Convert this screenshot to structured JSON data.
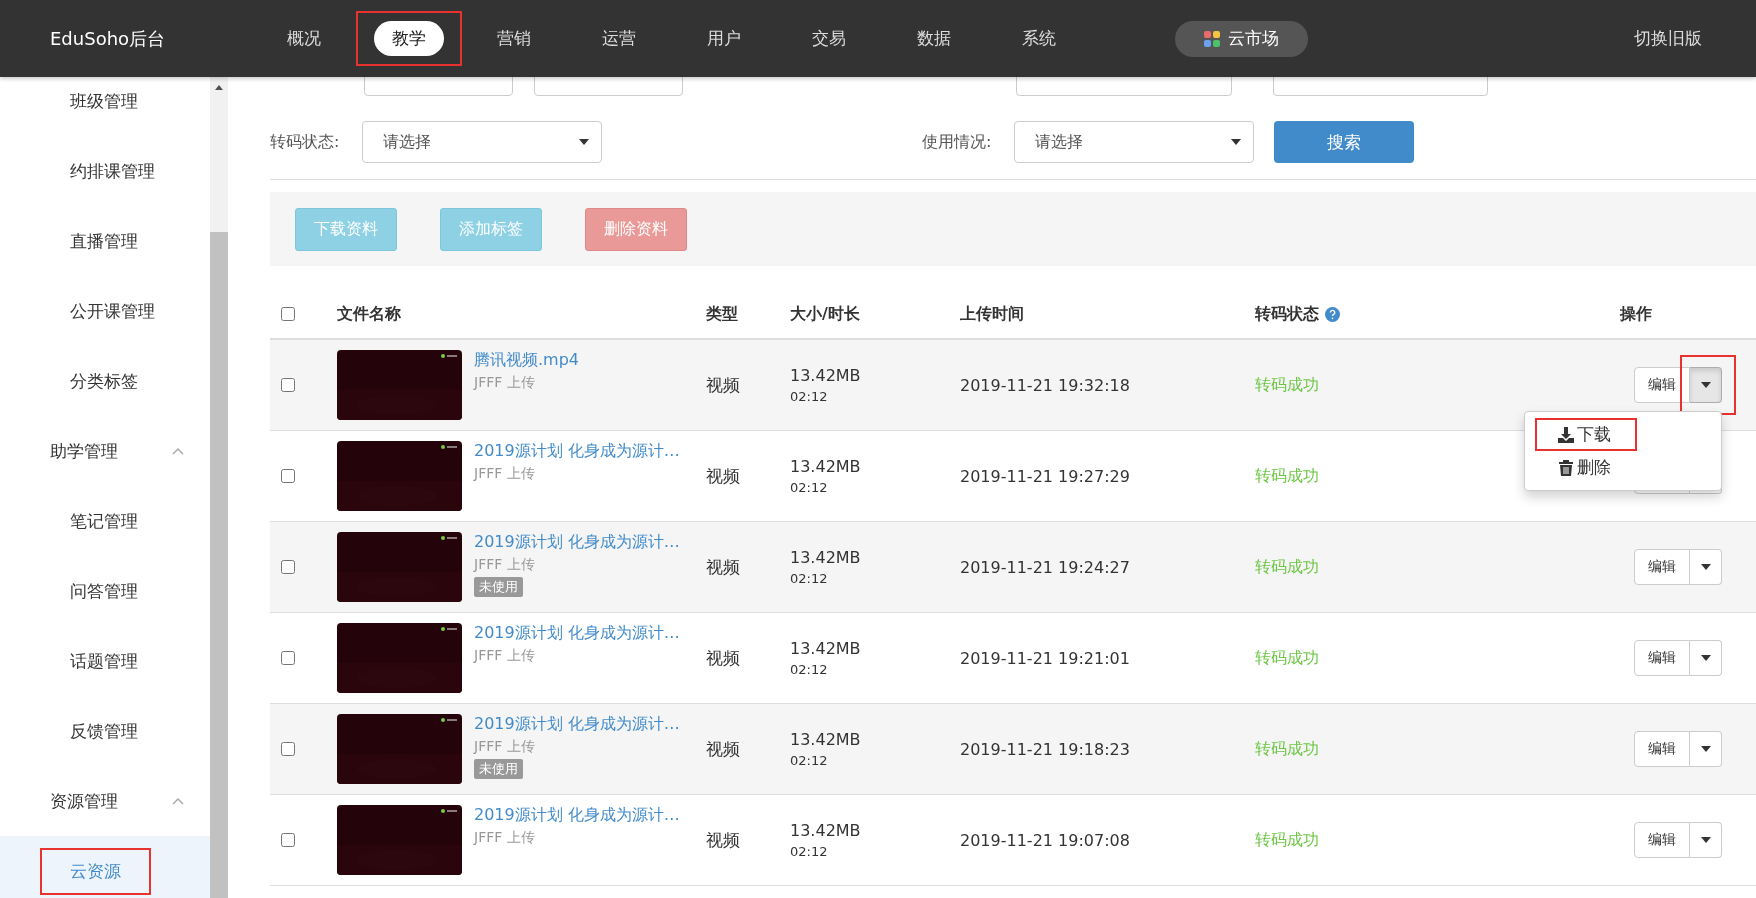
{
  "header": {
    "logo": "EduSoho后台",
    "nav": [
      {
        "label": "概况",
        "selected": false,
        "highlighted": false
      },
      {
        "label": "教学",
        "selected": true,
        "highlighted": true
      },
      {
        "label": "营销",
        "selected": false,
        "highlighted": false
      },
      {
        "label": "运营",
        "selected": false,
        "highlighted": false
      },
      {
        "label": "用户",
        "selected": false,
        "highlighted": false
      },
      {
        "label": "交易",
        "selected": false,
        "highlighted": false
      },
      {
        "label": "数据",
        "selected": false,
        "highlighted": false
      },
      {
        "label": "系统",
        "selected": false,
        "highlighted": false
      }
    ],
    "market": "云市场",
    "switch_link": "切换旧版"
  },
  "sidebar": {
    "items": [
      {
        "label": "班级管理",
        "selected": false,
        "highlighted": false
      },
      {
        "label": "约排课管理",
        "selected": false,
        "highlighted": false
      },
      {
        "label": "直播管理",
        "selected": false,
        "highlighted": false
      },
      {
        "label": "公开课管理",
        "selected": false,
        "highlighted": false
      },
      {
        "label": "分类标签",
        "selected": false,
        "highlighted": false
      },
      {
        "label": "助学管理",
        "selected": false,
        "highlighted": false,
        "expanded": true,
        "children": [
          {
            "label": "笔记管理",
            "selected": false,
            "highlighted": false
          },
          {
            "label": "问答管理",
            "selected": false,
            "highlighted": false
          },
          {
            "label": "话题管理",
            "selected": false,
            "highlighted": false
          },
          {
            "label": "反馈管理",
            "selected": false,
            "highlighted": false
          }
        ]
      },
      {
        "label": "资源管理",
        "selected": false,
        "highlighted": false,
        "expanded": true,
        "children": [
          {
            "label": "云资源",
            "selected": true,
            "highlighted": true
          }
        ]
      }
    ]
  },
  "filters": {
    "transcode": {
      "label": "转码状态:",
      "value": "请选择"
    },
    "usage": {
      "label": "使用情况:",
      "value": "请选择"
    },
    "search_button": "搜索"
  },
  "toolbar": {
    "buttons": [
      {
        "label": "下载资料",
        "kind": "info"
      },
      {
        "label": "添加标签",
        "kind": "info"
      },
      {
        "label": "删除资料",
        "kind": "danger"
      }
    ]
  },
  "table": {
    "select_all": {
      "checked": false
    },
    "columns": [
      {
        "label": "文件名称",
        "help": false
      },
      {
        "label": "类型",
        "help": false
      },
      {
        "label": "大小/时长",
        "help": false
      },
      {
        "label": "上传时间",
        "help": false
      },
      {
        "label": "转码状态",
        "help": true
      },
      {
        "label": "操作",
        "help": false
      }
    ],
    "rows": [
      {
        "checked": false,
        "title": "腾讯视频.mp4",
        "uploader": "JFFF 上传",
        "type": "视频",
        "size": "13.42MB",
        "duration": "02:12",
        "time": "2019-11-21 19:32:18",
        "status": "转码成功",
        "edit": "编辑",
        "menu_open": true,
        "toggle_highlighted": true,
        "menu": [
          {
            "label": "下载",
            "kind": "download",
            "highlighted": true
          },
          {
            "label": "删除",
            "kind": "delete",
            "highlighted": false
          }
        ]
      },
      {
        "checked": false,
        "title": "2019源计划 化身成为源计…",
        "uploader": "JFFF 上传",
        "type": "视频",
        "size": "13.42MB",
        "duration": "02:12",
        "time": "2019-11-21 19:27:29",
        "status": "转码成功",
        "menu_open": false,
        "toggle_highlighted": false
      },
      {
        "checked": false,
        "title": "2019源计划 化身成为源计…",
        "uploader": "JFFF 上传",
        "badge": "未使用",
        "type": "视频",
        "size": "13.42MB",
        "duration": "02:12",
        "time": "2019-11-21 19:24:27",
        "status": "转码成功",
        "edit": "编辑",
        "menu_open": false,
        "toggle_highlighted": false
      },
      {
        "checked": false,
        "title": "2019源计划 化身成为源计…",
        "uploader": "JFFF 上传",
        "type": "视频",
        "size": "13.42MB",
        "duration": "02:12",
        "time": "2019-11-21 19:21:01",
        "status": "转码成功",
        "edit": "编辑",
        "menu_open": false,
        "toggle_highlighted": false
      },
      {
        "checked": false,
        "title": "2019源计划 化身成为源计…",
        "uploader": "JFFF 上传",
        "badge": "未使用",
        "type": "视频",
        "size": "13.42MB",
        "duration": "02:12",
        "time": "2019-11-21 19:18:23",
        "status": "转码成功",
        "edit": "编辑",
        "menu_open": false,
        "toggle_highlighted": false
      },
      {
        "checked": false,
        "title": "2019源计划 化身成为源计…",
        "uploader": "JFFF 上传",
        "type": "视频",
        "size": "13.42MB",
        "duration": "02:12",
        "time": "2019-11-21 19:07:08",
        "status": "转码成功",
        "edit": "编辑",
        "menu_open": false,
        "toggle_highlighted": false
      }
    ]
  }
}
